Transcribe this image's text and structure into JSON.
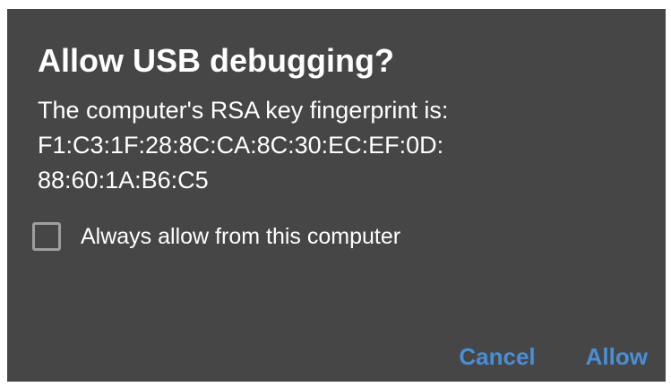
{
  "dialog": {
    "title": "Allow USB debugging?",
    "message_lines": [
      "The computer's RSA key fingerprint is:",
      "F1:C3:1F:28:8C:CA:8C:30:EC:EF:0D:",
      "88:60:1A:B6:C5"
    ],
    "checkbox": {
      "label": "Always allow from this computer",
      "checked": false
    },
    "buttons": {
      "cancel_label": "Cancel",
      "allow_label": "Allow"
    },
    "colors": {
      "background": "#464646",
      "text": "#ffffff",
      "accent": "#4a8ed6",
      "checkbox_border": "#9e9e9e"
    }
  }
}
